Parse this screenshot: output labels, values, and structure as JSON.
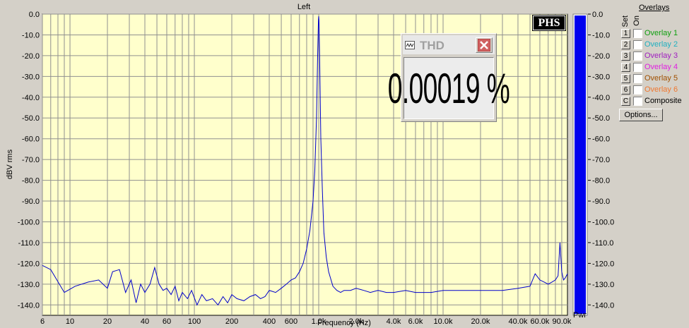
{
  "plot": {
    "title": "Left",
    "ylabel": "dBV rms",
    "xlabel": "Frequency (Hz)",
    "pwr_label": "Pwr"
  },
  "chart_data": {
    "type": "line",
    "title": "Left",
    "xlabel": "Frequency (Hz)",
    "ylabel": "dBV rms",
    "x_scale": "log",
    "xlim": [
      6,
      100000
    ],
    "ylim": [
      -145,
      0
    ],
    "grid": true,
    "y_ticks": [
      "0.0",
      "-10.0",
      "-20.0",
      "-30.0",
      "-40.0",
      "-50.0",
      "-60.0",
      "-70.0",
      "-80.0",
      "-90.0",
      "-100.0",
      "-110.0",
      "-120.0",
      "-130.0",
      "-140.0"
    ],
    "x_ticks": [
      {
        "v": 6,
        "label": "6"
      },
      {
        "v": 10,
        "label": "10"
      },
      {
        "v": 20,
        "label": "20"
      },
      {
        "v": 40,
        "label": "40"
      },
      {
        "v": 60,
        "label": "60"
      },
      {
        "v": 100,
        "label": "100"
      },
      {
        "v": 200,
        "label": "200"
      },
      {
        "v": 400,
        "label": "400"
      },
      {
        "v": 600,
        "label": "600"
      },
      {
        "v": 1000,
        "label": "1.0k"
      },
      {
        "v": 2000,
        "label": "2.0k"
      },
      {
        "v": 4000,
        "label": "4.0k"
      },
      {
        "v": 6000,
        "label": "6.0k"
      },
      {
        "v": 10000,
        "label": "10.0k"
      },
      {
        "v": 20000,
        "label": "20.0k"
      },
      {
        "v": 40000,
        "label": "40.0k"
      },
      {
        "v": 60000,
        "label": "60.0k"
      },
      {
        "v": 90000,
        "label": "90.0k"
      }
    ],
    "series": [
      {
        "x": [
          6,
          7,
          9,
          11,
          14,
          17,
          20,
          22,
          25,
          28,
          31,
          34,
          37,
          40,
          44,
          48,
          52,
          56,
          60,
          65,
          70,
          75,
          80,
          88,
          95,
          105,
          115,
          125,
          140,
          155,
          170,
          185,
          200,
          220,
          250,
          280,
          310,
          340,
          370,
          400,
          450,
          500,
          550,
          600,
          650,
          700,
          750,
          800,
          850,
          900,
          930,
          960,
          980,
          995,
          1000,
          1005,
          1020,
          1040,
          1070,
          1100,
          1150,
          1200,
          1300,
          1400,
          1500,
          1600,
          1800,
          2000,
          2300,
          2600,
          3000,
          3500,
          4000,
          5000,
          6000,
          8000,
          10000,
          13000,
          16000,
          20000,
          25000,
          30000,
          40000,
          50000,
          55000,
          60000,
          65000,
          70000,
          75000,
          80000,
          84000,
          87000,
          90000,
          93000,
          96000,
          100000
        ],
        "y": [
          -121,
          -123,
          -134,
          -131,
          -129,
          -128,
          -132,
          -124,
          -123,
          -134,
          -128,
          -139,
          -130,
          -134,
          -130,
          -122,
          -130,
          -133,
          -132,
          -135,
          -131,
          -138,
          -134,
          -137,
          -133,
          -140,
          -135,
          -138,
          -137,
          -140,
          -136,
          -139,
          -135,
          -137,
          -138,
          -136,
          -135,
          -137,
          -136,
          -133,
          -134,
          -132,
          -130,
          -128,
          -127,
          -124,
          -120,
          -113,
          -104,
          -90,
          -75,
          -50,
          -20,
          -3,
          -1,
          -3,
          -25,
          -60,
          -85,
          -105,
          -117,
          -124,
          -131,
          -133,
          -134,
          -133,
          -133,
          -132,
          -133,
          -134,
          -133,
          -134,
          -134,
          -133,
          -134,
          -134,
          -133,
          -133,
          -133,
          -133,
          -133,
          -133,
          -132,
          -131,
          -125,
          -128,
          -129,
          -130,
          -129,
          -128,
          -126,
          -110,
          -124,
          -128,
          -127,
          -125
        ]
      }
    ],
    "meter": {
      "level": -145,
      "ticks": [
        "0.0",
        "-10.0",
        "-20.0",
        "-30.0",
        "-40.0",
        "-50.0",
        "-60.0",
        "-70.0",
        "-80.0",
        "-90.0",
        "-100.0",
        "-110.0",
        "-120.0",
        "-130.0",
        "-140.0"
      ]
    }
  },
  "thd_window": {
    "title": "THD",
    "value": "0.00019 %"
  },
  "logo": "PHS",
  "overlays": {
    "heading": "Overlays",
    "set_label": "Set",
    "on_label": "On",
    "items": [
      {
        "num": "1",
        "label": "Overlay 1",
        "color": "#10a010"
      },
      {
        "num": "2",
        "label": "Overlay 2",
        "color": "#20b0c0"
      },
      {
        "num": "3",
        "label": "Overlay 3",
        "color": "#a020c0"
      },
      {
        "num": "4",
        "label": "Overlay 4",
        "color": "#e020e0"
      },
      {
        "num": "5",
        "label": "Overlay 5",
        "color": "#a05000"
      },
      {
        "num": "6",
        "label": "Overlay 6",
        "color": "#f07830"
      },
      {
        "num": "C",
        "label": "Composite",
        "color": "#000000"
      }
    ],
    "options_label": "Options..."
  },
  "colors": {
    "plot_bg": "#ffffcc",
    "grid": "#909090",
    "trace": "#0000cc",
    "meter": "#0000ee"
  }
}
